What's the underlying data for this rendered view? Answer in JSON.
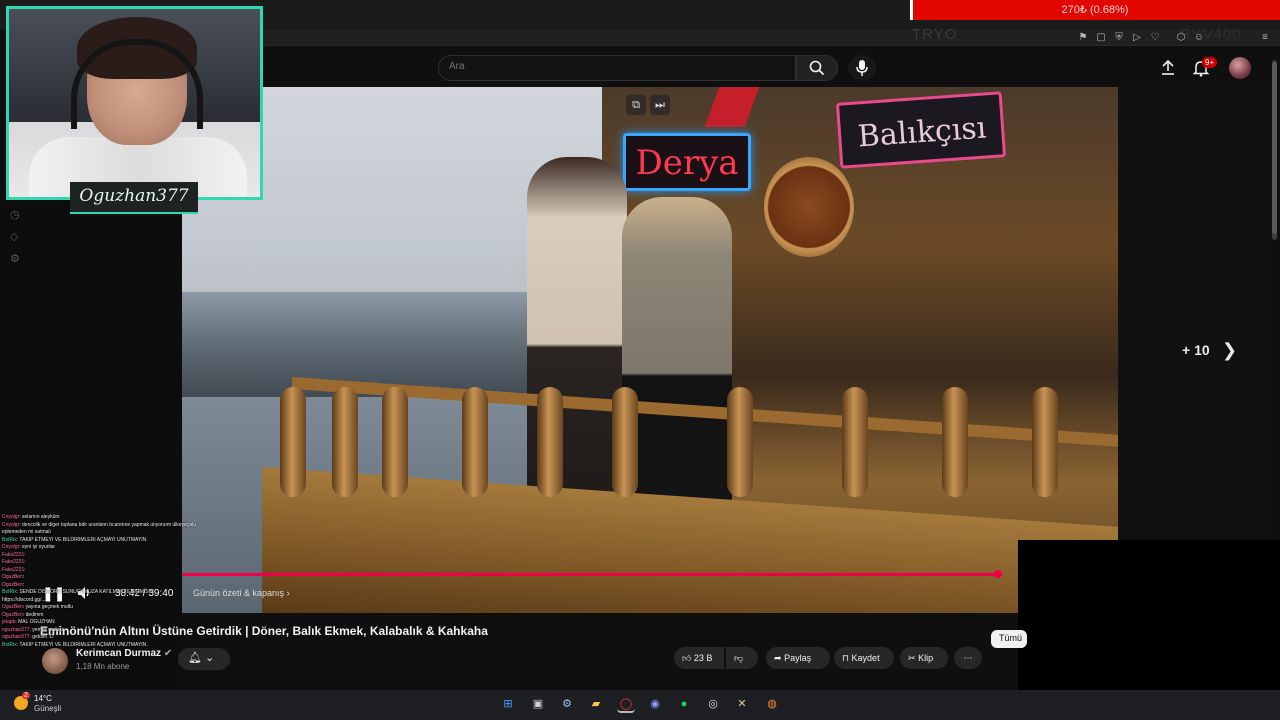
{
  "browser": {
    "donation_text": "270₺ (0.68%)",
    "overlay_label": "TRYO",
    "overlay_label_2": "RYV400"
  },
  "search": {
    "placeholder": "Ara"
  },
  "header": {
    "notification_count": "9+"
  },
  "webcam": {
    "streamer_name": "Oguzhan377"
  },
  "player": {
    "time": "38:42 / 39:40",
    "chapter_label": "Günün özeti & kapanış",
    "more_items": "+ 10",
    "progress_fraction": 0.976,
    "accent_color": "#f1004a"
  },
  "video": {
    "title": "Eminönü'nün Altını Üstüne Getirdik | Döner, Balık Ekmek, Kalabalık & Kahkaha",
    "channel_name": "Kerimcan Durmaz",
    "subscribers": "1,18 Mn abone",
    "sign_1": "Derya",
    "sign_2": "Balıkçısı"
  },
  "actions": {
    "like_count": "23 B",
    "share": "Paylaş",
    "save": "Kaydet",
    "clip": "Klip",
    "chip_all": "Tümü"
  },
  "chat": [
    {
      "user": "Cnyolgr",
      "text": ": selamın aleyküm"
    },
    {
      "user": "Cnyolgr",
      "text": ": dencolik ve diger toplana bdir uranlann bcaretıne yapmak ulıyoruım ülkeyeçalu"
    },
    {
      "user": "",
      "text": "eplemeden mi satmalı"
    },
    {
      "user": "BotRix",
      "text": ": TAKİP ETMEYİ VE BİLDİRİMLERİ AÇMAYI UNUTMAYIN."
    },
    {
      "user": "Cnyolgr",
      "text": ": eyni iyi oyunlar"
    },
    {
      "user": "Fako2231",
      "text": ":"
    },
    {
      "user": "Fako2231",
      "text": ":"
    },
    {
      "user": "Fako2231",
      "text": ":"
    },
    {
      "user": "OguzBen",
      "text": ":"
    },
    {
      "user": "OguzBen",
      "text": ":"
    },
    {
      "user": "BotRix",
      "text": ": SENDE DİSCORD SUNUCUMUZA KATILMAK İSTERMİSİN"
    },
    {
      "user": "",
      "text": "https://discord.gg/..."
    },
    {
      "user": "OguzBen",
      "text": ": yayına geçmek mutlu"
    },
    {
      "user": "OguzBen",
      "text": ": dedimm"
    },
    {
      "user": "jelapb",
      "text": ": MAL OGUZHAN"
    },
    {
      "user": "oguzhan377",
      "text": ": yemek molası"
    },
    {
      "user": "oguzhan377",
      "text": ": geldim :D"
    },
    {
      "user": "BotRix",
      "text": ": TAKİP ETMEYİ VE BİLDİRİMLERİ AÇMAYI UNUTMAYIN."
    }
  ],
  "taskbar": {
    "temperature": "14°C",
    "condition": "Güneşli",
    "weather_badge": "2"
  }
}
